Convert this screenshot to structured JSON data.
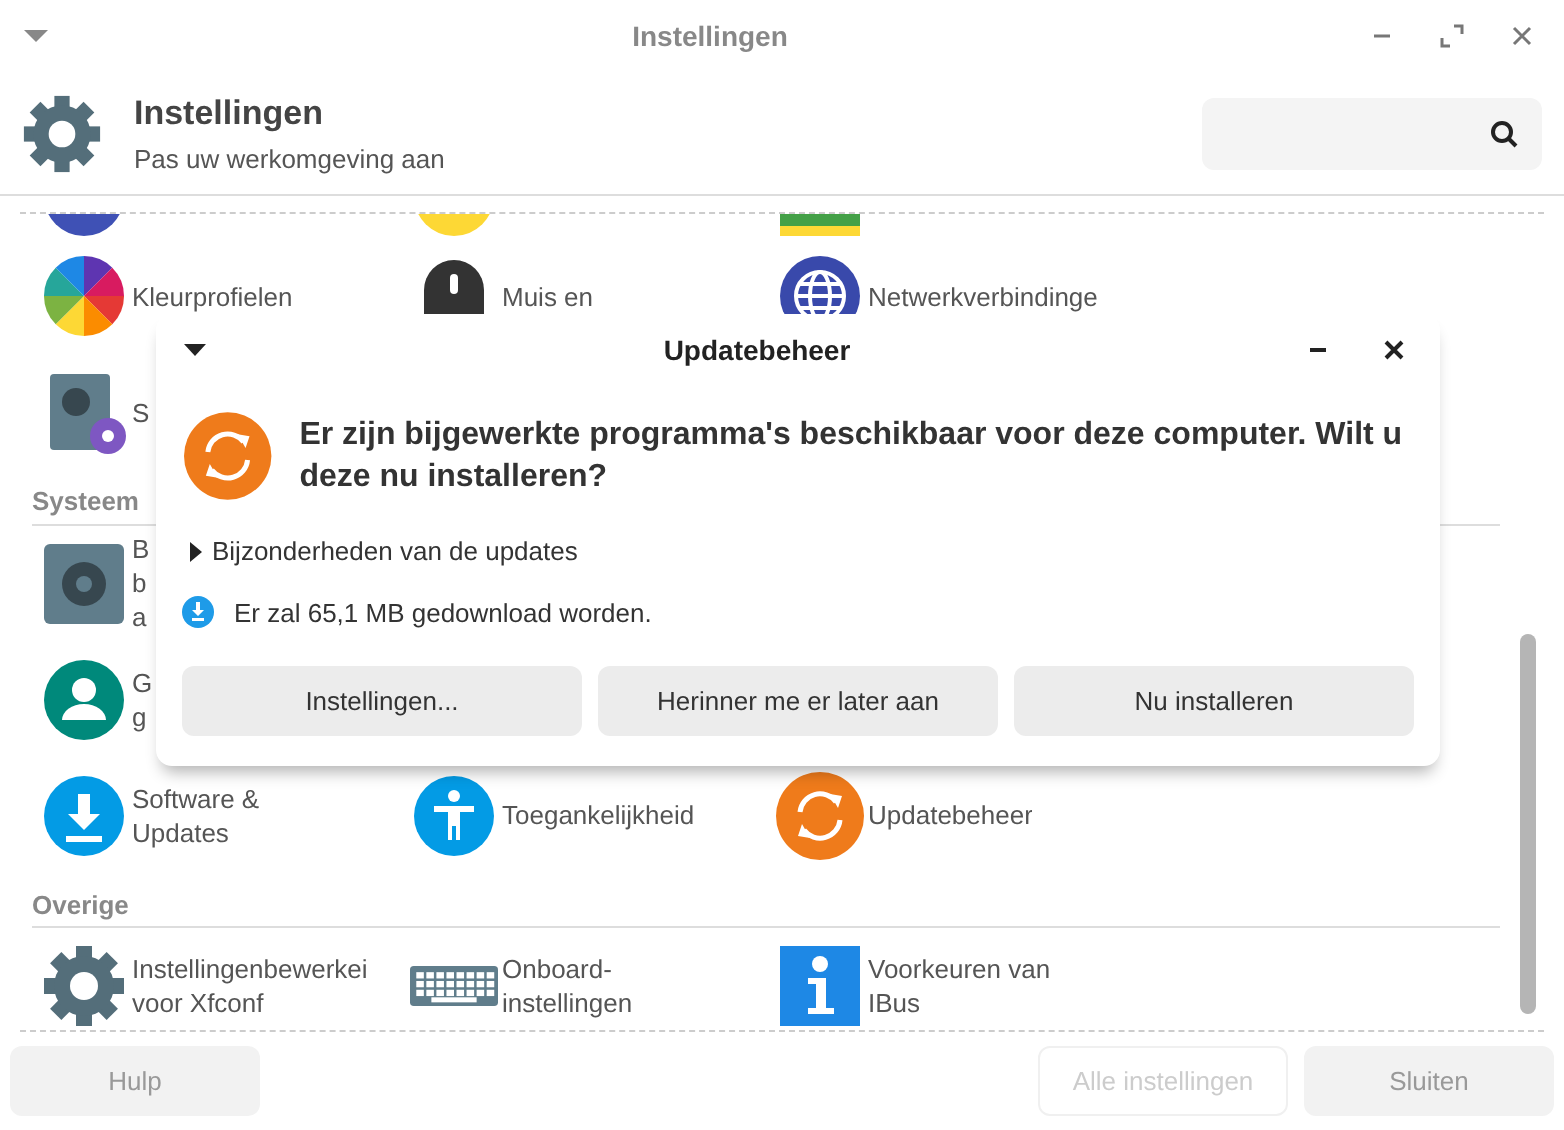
{
  "window": {
    "title": "Instellingen"
  },
  "header": {
    "title": "Instellingen",
    "subtitle": "Pas uw werkomgeving aan"
  },
  "sections": [
    {
      "items": [
        {
          "label": "Kleurprofielen"
        },
        {
          "label": "Muis en"
        },
        {
          "label": "Netwerkverbindinge"
        }
      ]
    },
    {
      "items": [
        {
          "label": "S"
        }
      ]
    },
    {
      "title": "Systeem",
      "items": [
        {
          "label": "B\nb\na"
        }
      ]
    },
    {
      "items": [
        {
          "label": "G\ng"
        }
      ]
    },
    {
      "items": [
        {
          "label": "Software &\nUpdates"
        },
        {
          "label": "Toegankelijkheid"
        },
        {
          "label": "Updatebeheer"
        }
      ]
    },
    {
      "title": "Overige",
      "items": [
        {
          "label": "Instellingenbewerkei\nvoor Xfconf"
        },
        {
          "label": "Onboard-\ninstellingen"
        },
        {
          "label": "Voorkeuren van\nIBus"
        }
      ]
    }
  ],
  "footer": {
    "buttons": [
      {
        "label": "Hulp",
        "disabled": false
      },
      {
        "label": "Alle instellingen",
        "disabled": true
      },
      {
        "label": "Sluiten",
        "disabled": false
      }
    ]
  },
  "dialog": {
    "title": "Updatebeheer",
    "message": "Er zijn bijgewerkte programma's beschikbaar voor deze computer. Wilt u deze nu installeren?",
    "details": {
      "label": "Bijzonderheden van de updates",
      "expanded": false
    },
    "download_note": "Er zal 65,1 MB gedownload worden.",
    "buttons": [
      "Instellingen...",
      "Herinner me er later aan",
      "Nu installeren"
    ]
  }
}
